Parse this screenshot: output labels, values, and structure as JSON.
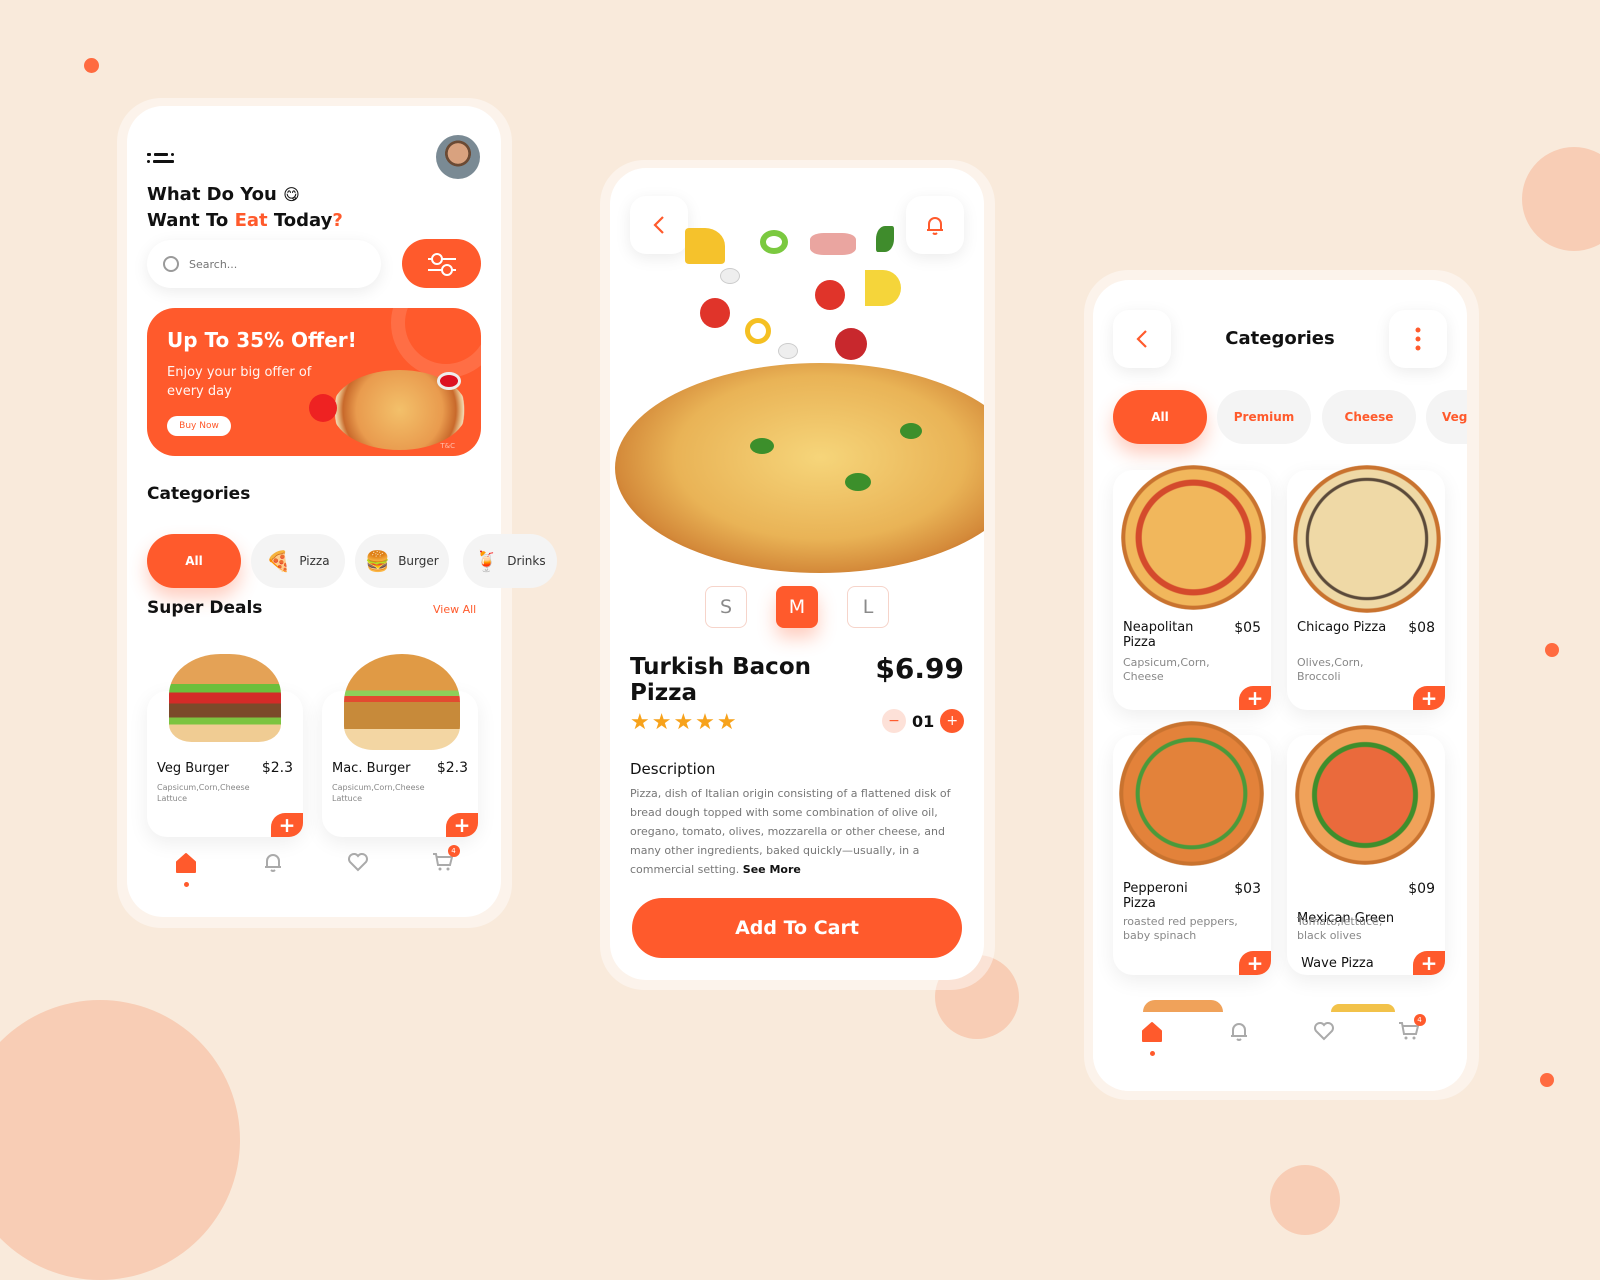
{
  "colors": {
    "accent": "#ff5a2c",
    "background": "#f9eadb",
    "text": "#111111",
    "muted": "#8a8a8a"
  },
  "screen1": {
    "menu_icon": "menu-icon",
    "avatar_alt": "user-avatar",
    "greeting_line1": "What Do You",
    "greeting_emoji": "😋",
    "greeting_line2_pre": "Want To ",
    "greeting_line2_accent": "Eat",
    "greeting_line2_post": " Today",
    "greeting_line2_mark": "?",
    "search": {
      "placeholder": "Search..."
    },
    "filter_icon": "sliders-icon",
    "banner": {
      "title": "Up To 35% Offer!",
      "subtitle_line1": "Enjoy your big offer of",
      "subtitle_line2": "every day",
      "button": "Buy Now",
      "terms": "T&C"
    },
    "categories_title": "Categories",
    "categories": [
      {
        "label": "All",
        "emoji": "",
        "active": true
      },
      {
        "label": "Pizza",
        "emoji": "🍕",
        "active": false
      },
      {
        "label": "Burger",
        "emoji": "🍔",
        "active": false
      },
      {
        "label": "Drinks",
        "emoji": "🍹",
        "active": false
      }
    ],
    "deals_title": "Super Deals",
    "view_all": "View All",
    "deals": [
      {
        "name": "Veg Burger",
        "price": "$2.3",
        "desc_line1": "Capsicum,Corn,Cheese",
        "desc_line2": "Lattuce"
      },
      {
        "name": "Mac. Burger",
        "price": "$2.3",
        "desc_line1": "Capsicum,Corn,Cheese",
        "desc_line2": "Lattuce"
      }
    ],
    "add_label": "+",
    "nav": {
      "cart_badge": "4",
      "active": "home"
    }
  },
  "screen2": {
    "back_icon": "back-chevron-icon",
    "bell_icon": "bell-icon",
    "sizes": [
      {
        "label": "S",
        "active": false
      },
      {
        "label": "M",
        "active": true
      },
      {
        "label": "L",
        "active": false
      }
    ],
    "title_line1": "Turkish Bacon",
    "title_line2": "Pizza",
    "price": "$6.99",
    "rating": 5,
    "stars": "★★★★★",
    "quantity": "01",
    "minus_label": "−",
    "plus_label": "+",
    "description_title": "Description",
    "description": "Pizza, dish of Italian origin consisting of a flattened disk of bread dough topped with some combination of olive oil, oregano, tomato, olives, mozzarella or other cheese, and many other ingredients, baked quickly—usually, in a commercial setting.",
    "see_more": "See More",
    "add_to_cart": "Add To Cart"
  },
  "screen3": {
    "title": "Categories",
    "tabs": [
      {
        "label": "All",
        "active": true
      },
      {
        "label": "Premium",
        "active": false
      },
      {
        "label": "Cheese",
        "active": false
      },
      {
        "label": "Veg",
        "active": false
      }
    ],
    "items": [
      {
        "name_line1": "Neapolitan",
        "name_line2": "Pizza",
        "price": "$05",
        "desc_line1": "Capsicum,Corn,",
        "desc_line2": "Cheese"
      },
      {
        "name_line1": "Chicago Pizza",
        "name_line2": "",
        "price": "$08",
        "desc_line1": "Olives,Corn,",
        "desc_line2": "Broccoli"
      },
      {
        "name_line1": "Pepperoni",
        "name_line2": "Pizza",
        "price": "$03",
        "desc_line1": "roasted red peppers,",
        "desc_line2": "baby spinach"
      },
      {
        "name_line1": "Mexican Green",
        "name_line2": " Wave Pizza",
        "price": "$09",
        "desc_line1": "Tomato,lettuce,",
        "desc_line2": "black olives"
      }
    ],
    "add_label": "+",
    "nav": {
      "cart_badge": "4",
      "active": "home"
    }
  }
}
